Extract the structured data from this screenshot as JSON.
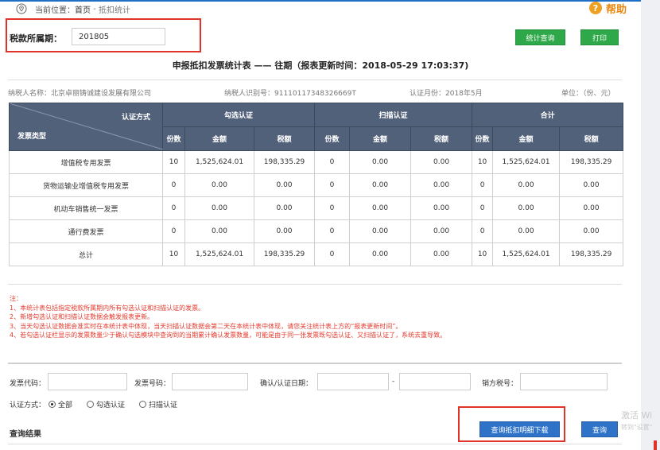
{
  "breadcrumb": {
    "label": "当前位置：",
    "home": "首页",
    "separator": " - ",
    "current": "抵扣统计"
  },
  "help_label": "帮助",
  "period": {
    "label": "税款所属期：",
    "value": "201805"
  },
  "buttons": {
    "stat_query": "统计查询",
    "print": "打印",
    "download": "查询抵扣明细下载",
    "search": "查询"
  },
  "report": {
    "title": "申报抵扣发票统计表 —— 往期（报表更新时间：2018-05-29 17:03:37)",
    "taxpayer_name": "纳税人名称：北京卓丽铸诚建设发展有限公司",
    "taxpayer_id": "纳税人识别号：91110117348326669T",
    "cert_month": "认证月份：2018年5月",
    "unit": "单位：（份、元）"
  },
  "table": {
    "corner_top": "认证方式",
    "corner_bottom": "发票类型",
    "groups": [
      "勾选认证",
      "扫描认证",
      "合计"
    ],
    "subheaders": [
      "份数",
      "金额",
      "税额"
    ],
    "rows": [
      {
        "type": "增值税专用发票",
        "v": [
          "10",
          "1,525,624.01",
          "198,335.29",
          "0",
          "0.00",
          "0.00",
          "10",
          "1,525,624.01",
          "198,335.29"
        ]
      },
      {
        "type": "货物运输业增值税专用发票",
        "v": [
          "0",
          "0.00",
          "0.00",
          "0",
          "0.00",
          "0.00",
          "0",
          "0.00",
          "0.00"
        ]
      },
      {
        "type": "机动车销售统一发票",
        "v": [
          "0",
          "0.00",
          "0.00",
          "0",
          "0.00",
          "0.00",
          "0",
          "0.00",
          "0.00"
        ]
      },
      {
        "type": "通行费发票",
        "v": [
          "0",
          "0.00",
          "0.00",
          "0",
          "0.00",
          "0.00",
          "0",
          "0.00",
          "0.00"
        ]
      },
      {
        "type": "总计",
        "v": [
          "10",
          "1,525,624.01",
          "198,335.29",
          "0",
          "0.00",
          "0.00",
          "10",
          "1,525,624.01",
          "198,335.29"
        ]
      }
    ]
  },
  "notes": {
    "title": "注：",
    "items": [
      "1、本统计表包括指定税款所属期内所有勾选认证和扫描认证的发票。",
      "2、新增勾选认证和扫描认证数据会触发报表更新。",
      "3、当天勾选认证数据会准实时在本统计表中体现，当天扫描认证数据会第二天在本统计表中体现，请您关注统计表上方的“报表更新时间”。",
      "4、若勾选认证栏显示的发票数量少于确认勾选模块中查询到的当期累计确认发票数量，可能是由于同一张发票既勾选认证、又扫描认证了，系统去重导致。"
    ]
  },
  "filters": {
    "invoice_code": "发票代码：",
    "invoice_number": "发票号码：",
    "cert_date": "确认/认证日期：",
    "date_sep": "-",
    "seller_tax_id": "销方税号：",
    "cert_method_label": "认证方式：",
    "options": [
      "全部",
      "勾选认证",
      "扫描认证"
    ],
    "selected": "全部"
  },
  "results_title": "查询结果",
  "watermark": {
    "line1": "激活 Wi",
    "line2": "转到\"设置\""
  },
  "colors": {
    "header_bg": "#52617a",
    "green": "#2fa84a",
    "blue": "#2f73c9",
    "red": "#e0342b",
    "orange": "#e8870e"
  }
}
